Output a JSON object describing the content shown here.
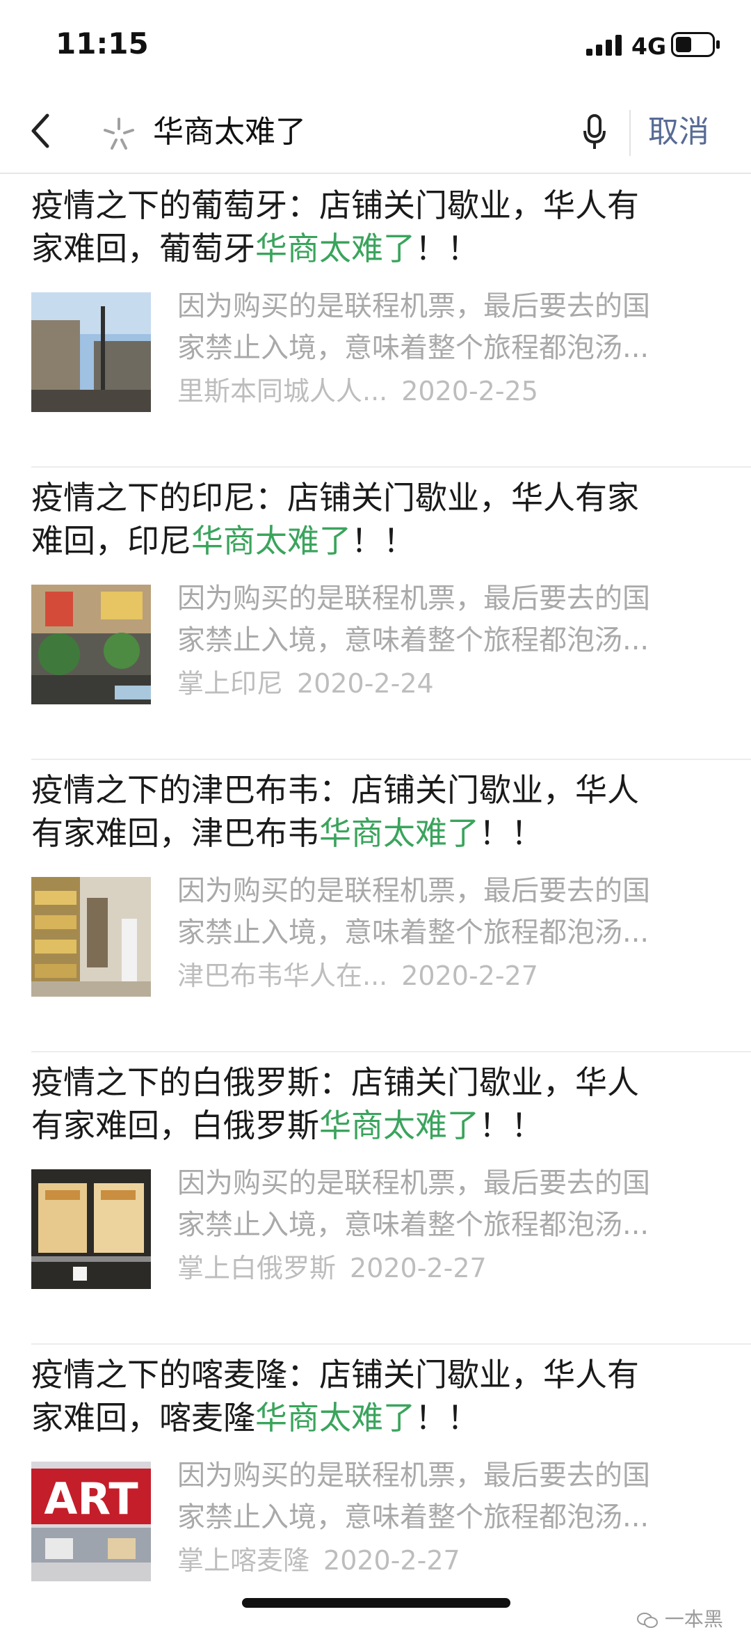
{
  "status_bar": {
    "time": "11:15",
    "network": "4G",
    "battery_icon": "battery-icon",
    "signal_icon": "signal-icon"
  },
  "search": {
    "back_icon": "chevron-left-icon",
    "search_icon": "search-spark-icon",
    "query": "华商太难了",
    "mic_icon": "microphone-icon",
    "cancel_label": "取消"
  },
  "colors": {
    "highlight": "#3aa45c",
    "cancel": "#576b95",
    "secondary_text": "#a9a9a9"
  },
  "results": [
    {
      "title_line1": "疫情之下的葡萄牙：店铺关门歇业，华人有",
      "title_line2_pre": "家难回，葡萄牙",
      "title_highlight": "华商太难了",
      "title_post": "！！",
      "desc_line1": "因为购买的是联程机票，最后要去的国",
      "desc_line2": "家禁止入境，意味着整个旅程都泡汤...",
      "source": "里斯本同城人人...",
      "date": "2020-2-25"
    },
    {
      "title_line1": "疫情之下的印尼：店铺关门歇业，华人有家",
      "title_line2_pre": "难回，印尼",
      "title_highlight": "华商太难了",
      "title_post": "！！",
      "desc_line1": "因为购买的是联程机票，最后要去的国",
      "desc_line2": "家禁止入境，意味着整个旅程都泡汤...",
      "source": "掌上印尼",
      "date": "2020-2-24"
    },
    {
      "title_line1": "疫情之下的津巴布韦：店铺关门歇业，华人",
      "title_line2_pre": "有家难回，津巴布韦",
      "title_highlight": "华商太难了",
      "title_post": "！！",
      "desc_line1": "因为购买的是联程机票，最后要去的国",
      "desc_line2": "家禁止入境，意味着整个旅程都泡汤...",
      "source": "津巴布韦华人在...",
      "date": "2020-2-27"
    },
    {
      "title_line1": "疫情之下的白俄罗斯：店铺关门歇业，华人",
      "title_line2_pre": "有家难回，白俄罗斯",
      "title_highlight": "华商太难了",
      "title_post": "！！",
      "desc_line1": "因为购买的是联程机票，最后要去的国",
      "desc_line2": "家禁止入境，意味着整个旅程都泡汤...",
      "source": "掌上白俄罗斯",
      "date": "2020-2-27"
    },
    {
      "title_line1": "疫情之下的喀麦隆：店铺关门歇业，华人有",
      "title_line2_pre": "家难回，喀麦隆",
      "title_highlight": "华商太难了",
      "title_post": "！！",
      "desc_line1": "因为购买的是联程机票，最后要去的国",
      "desc_line2": "家禁止入境，意味着整个旅程都泡汤...",
      "source": "掌上喀麦隆",
      "date": "2020-2-27",
      "thumb_sign_text": "ART"
    }
  ],
  "watermark": {
    "text": "一本黑",
    "icon": "wechat-icon"
  }
}
